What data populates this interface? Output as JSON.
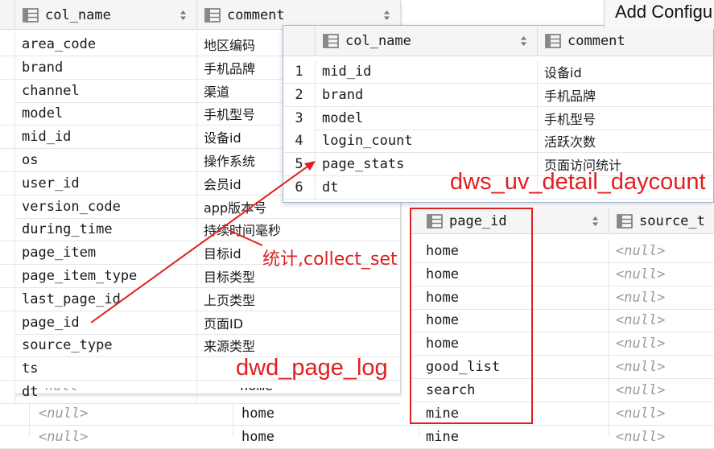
{
  "window": {
    "title": "Add Configu"
  },
  "headers": {
    "col_name": "col_name",
    "comment": "comment",
    "page_id": "page_id",
    "source_type": "source_t"
  },
  "background": {
    "rows": [
      {
        "left": "<null>",
        "mid": "home",
        "page_id": "mine",
        "source": "<null>"
      },
      {
        "left": "<null>",
        "mid": "home",
        "page_id": "mine",
        "source": "<null>"
      }
    ]
  },
  "dwd_page_log": {
    "rows": [
      {
        "col_name": "area_code",
        "comment": "地区编码"
      },
      {
        "col_name": "brand",
        "comment": "手机品牌"
      },
      {
        "col_name": "channel",
        "comment": "渠道"
      },
      {
        "col_name": "model",
        "comment": "手机型号"
      },
      {
        "col_name": "mid_id",
        "comment": "设备id"
      },
      {
        "col_name": "os",
        "comment": "操作系统"
      },
      {
        "col_name": "user_id",
        "comment": "会员id"
      },
      {
        "col_name": "version_code",
        "comment": "app版本号"
      },
      {
        "col_name": "during_time",
        "comment": "持续时间毫秒"
      },
      {
        "col_name": "page_item",
        "comment": "目标id"
      },
      {
        "col_name": "page_item_type",
        "comment": "目标类型"
      },
      {
        "col_name": "last_page_id",
        "comment": "上页类型"
      },
      {
        "col_name": "page_id",
        "comment": "页面ID"
      },
      {
        "col_name": "source_type",
        "comment": "来源类型"
      },
      {
        "col_name": "ts",
        "comment": ""
      },
      {
        "col_name": "dt",
        "comment": ""
      }
    ],
    "behind_row": {
      "left": "null",
      "mid": "home"
    }
  },
  "dws_uv_detail_daycount": {
    "rows": [
      {
        "num": "1",
        "col_name": "mid_id",
        "comment": "设备id"
      },
      {
        "num": "2",
        "col_name": "brand",
        "comment": "手机品牌"
      },
      {
        "num": "3",
        "col_name": "model",
        "comment": "手机型号"
      },
      {
        "num": "4",
        "col_name": "login_count",
        "comment": "活跃次数"
      },
      {
        "num": "5",
        "col_name": "page_stats",
        "comment": "页面访问统计"
      },
      {
        "num": "6",
        "col_name": "dt",
        "comment": ""
      }
    ]
  },
  "page_id_table": {
    "rows": [
      {
        "page_id": "home",
        "source": "<null>"
      },
      {
        "page_id": "home",
        "source": "<null>"
      },
      {
        "page_id": "home",
        "source": "<null>"
      },
      {
        "page_id": "home",
        "source": "<null>"
      },
      {
        "page_id": "home",
        "source": "<null>"
      },
      {
        "page_id": "good_list",
        "source": "<null>"
      },
      {
        "page_id": "search",
        "source": "<null>"
      },
      {
        "page_id": "mine",
        "source": "<null>"
      }
    ]
  },
  "annotations": {
    "target_table": "dws_uv_detail_daycount",
    "source_table": "dwd_page_log",
    "collect_label": "统计,collect_set"
  },
  "colors": {
    "annotation": "#e02020",
    "header_bg": "#f5f5f5",
    "grid": "#e6e6e6"
  },
  "icons": {
    "column_header": "table-column-icon",
    "sort": "sort-arrows-icon"
  }
}
